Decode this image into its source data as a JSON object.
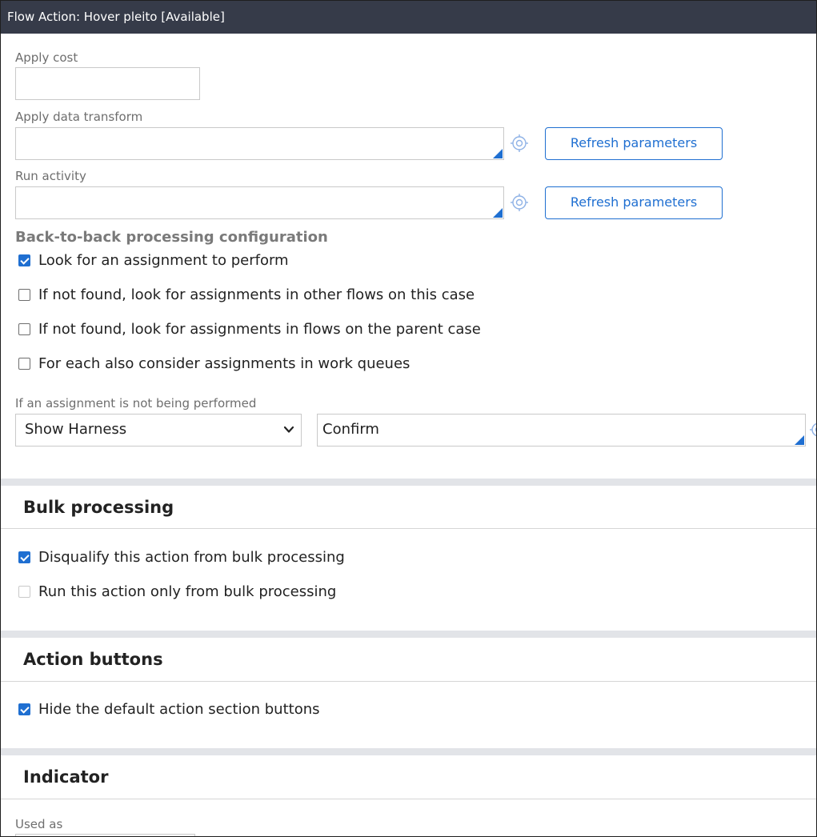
{
  "window": {
    "title": "Flow Action: Hover pleito [Available]"
  },
  "form": {
    "apply_cost": {
      "label": "Apply cost",
      "value": ""
    },
    "apply_data_transform": {
      "label": "Apply data transform",
      "value": "",
      "button_label": "Refresh parameters"
    },
    "run_activity": {
      "label": "Run activity",
      "value": "",
      "button_label": "Refresh parameters"
    }
  },
  "back_to_back": {
    "heading": "Back-to-back processing configuration",
    "options": [
      {
        "label": "Look for an assignment to perform",
        "checked": true
      },
      {
        "label": "If not found, look for assignments in other flows on this case",
        "checked": false
      },
      {
        "label": "If not found, look for assignments in flows on the parent case",
        "checked": false
      },
      {
        "label": "For each also consider assignments in work queues",
        "checked": false
      }
    ],
    "not_performed_label": "If an assignment is not being performed",
    "harness_select": "Show Harness",
    "harness_value": "Confirm"
  },
  "bulk_processing": {
    "title": "Bulk processing",
    "options": [
      {
        "label": "Disqualify this action from bulk processing",
        "checked": true,
        "disabled": false
      },
      {
        "label": "Run this action only from bulk processing",
        "checked": false,
        "disabled": true
      }
    ]
  },
  "action_buttons": {
    "title": "Action buttons",
    "options": [
      {
        "label": "Hide the default action section buttons",
        "checked": true
      }
    ]
  },
  "indicator": {
    "title": "Indicator",
    "used_as_label": "Used as"
  },
  "colors": {
    "accent": "#1f6fd1",
    "titlebar": "#363b49",
    "band": "#e2e4e8"
  },
  "icons": {
    "target": "crosshair-icon",
    "dropdown": "chevron-down-icon",
    "checkbox": "checkbox-icon"
  }
}
